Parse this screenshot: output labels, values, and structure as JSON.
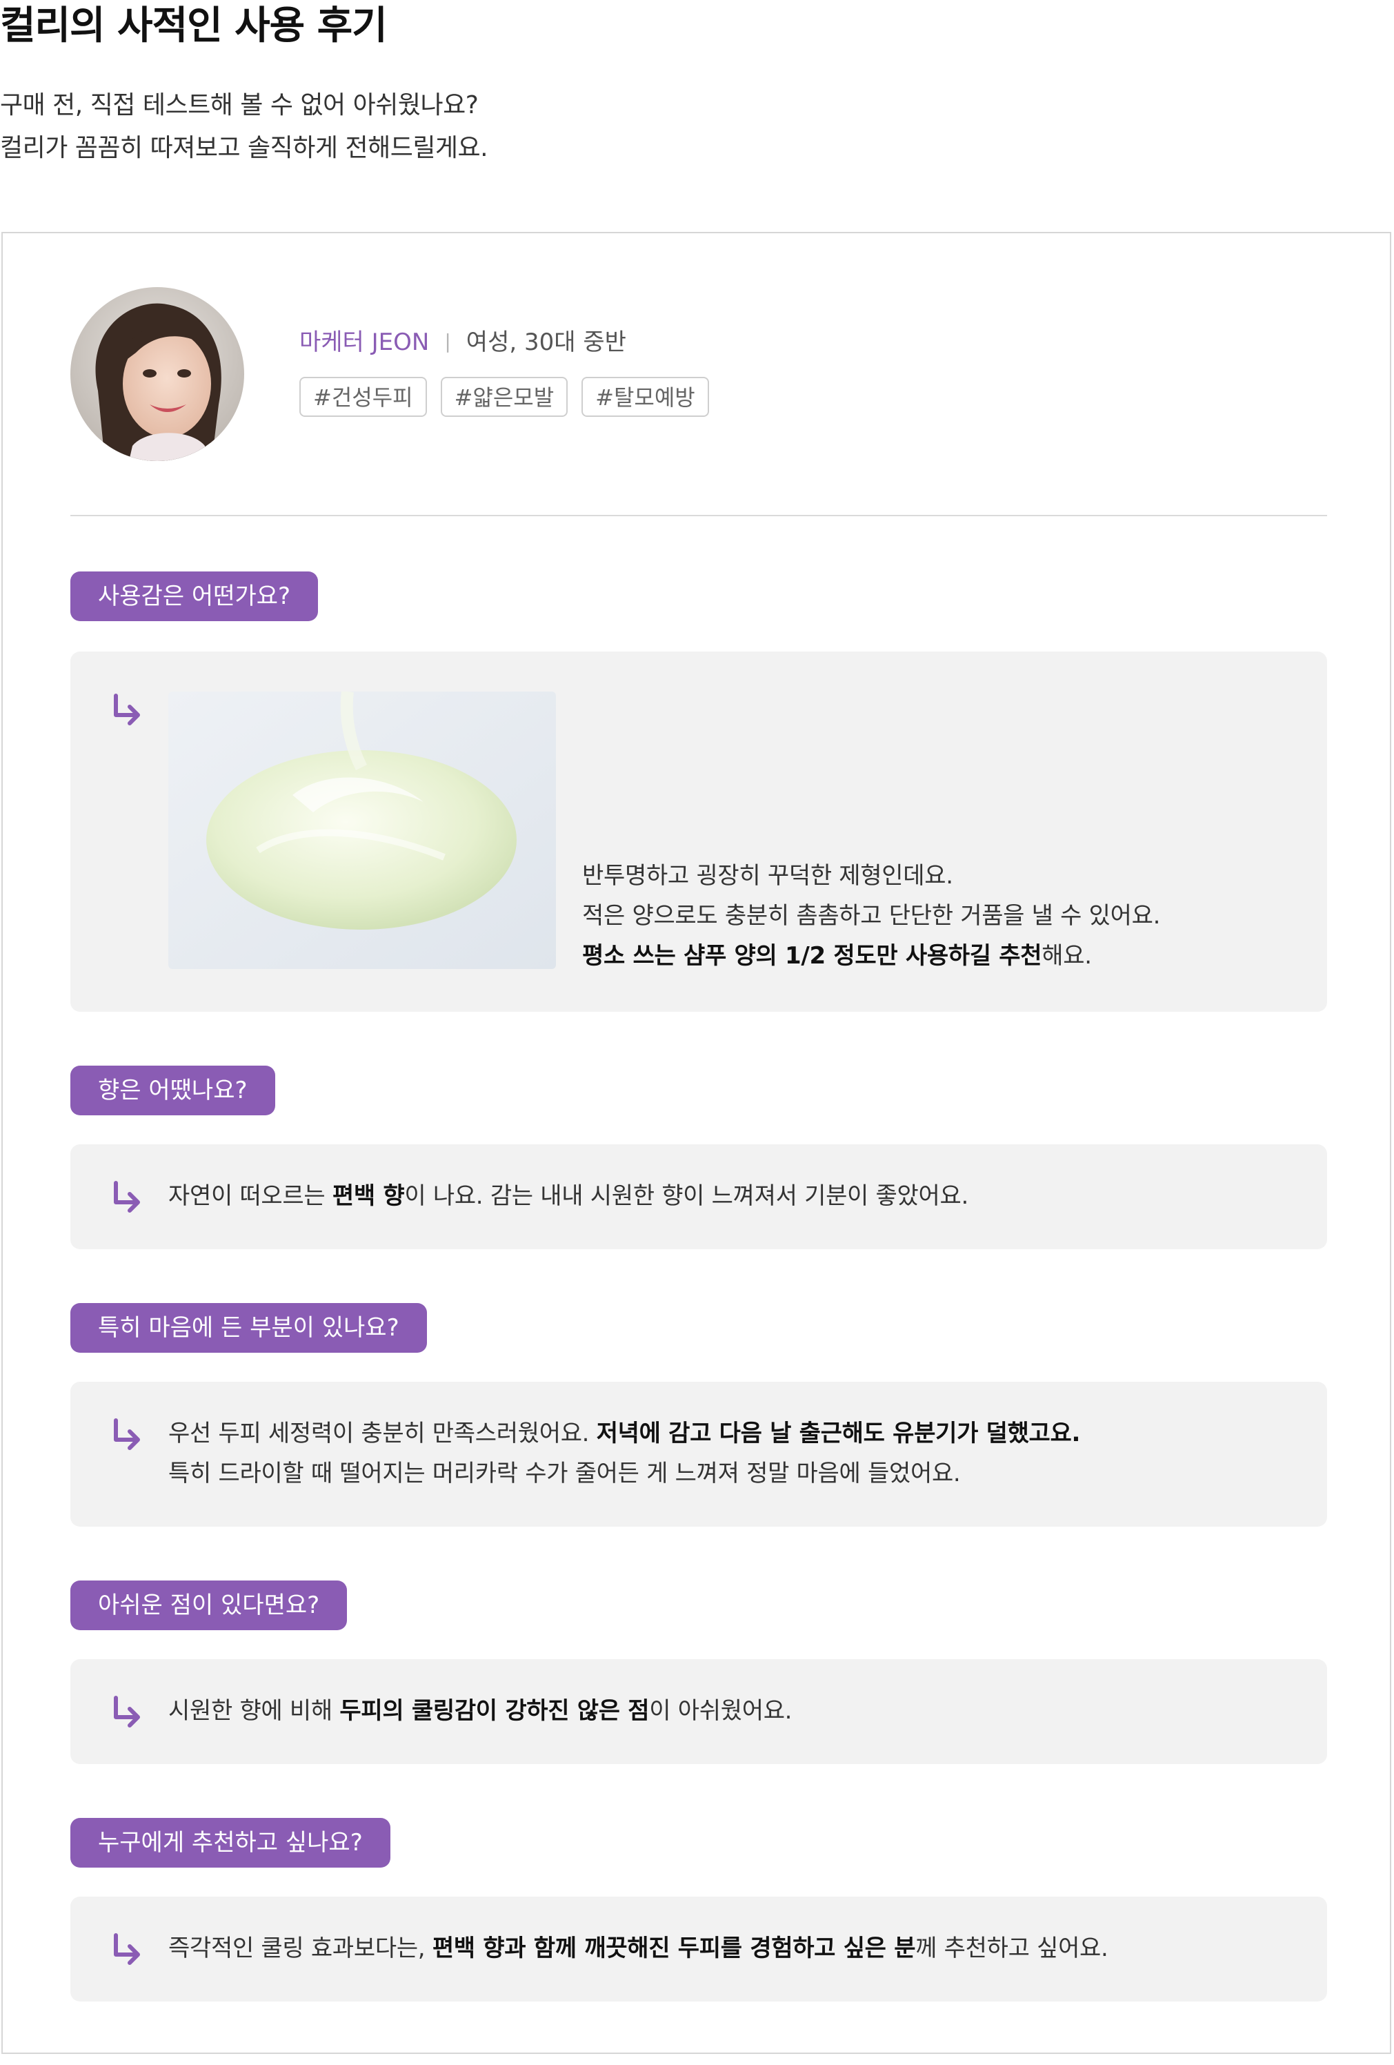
{
  "page": {
    "title": "컬리의 사적인 사용 후기",
    "intro_lines": [
      "구매 전, 직접 테스트해 볼 수 없어 아쉬웠나요?",
      "컬리가 꼼꼼히 따져보고 솔직하게 전해드릴게요."
    ]
  },
  "reviewer": {
    "name": "마케터 JEON",
    "separator": "|",
    "info": "여성, 30대 중반",
    "tags": [
      "#건성두피",
      "#얇은모발",
      "#탈모예방"
    ]
  },
  "colors": {
    "accent": "#8a5cb4",
    "answer_bg": "#f2f2f2",
    "border": "#d6d6d6"
  },
  "icons": {
    "answer_arrow": "arrow-down-right-icon"
  },
  "qa": [
    {
      "question": "사용감은 어떤가요?",
      "lines": [
        [
          {
            "t": "반투명하고 굉장히 꾸덕한 제형인데요."
          }
        ],
        [
          {
            "t": "적은 양으로도 충분히 촘촘하고 단단한 거품을 낼 수 있어요."
          }
        ],
        [
          {
            "t": "평소 쓰는 샴푸 양의 1/2 정도만 사용하길 추천",
            "b": true
          },
          {
            "t": "해요."
          }
        ]
      ]
    },
    {
      "question": "향은 어땠나요?",
      "lines": [
        [
          {
            "t": "자연이 떠오르는 "
          },
          {
            "t": "편백 향",
            "b": true
          },
          {
            "t": "이 나요. 감는 내내 시원한 향이 느껴져서 기분이 좋았어요."
          }
        ]
      ]
    },
    {
      "question": "특히 마음에 든 부분이 있나요?",
      "lines": [
        [
          {
            "t": "우선 두피 세정력이 충분히 만족스러웠어요. "
          },
          {
            "t": "저녁에 감고 다음 날 출근해도 유분기가 덜했고요.",
            "b": true
          }
        ],
        [
          {
            "t": "특히 드라이할 때 떨어지는 머리카락 수가 줄어든 게 느껴져 정말 마음에 들었어요."
          }
        ]
      ]
    },
    {
      "question": "아쉬운 점이 있다면요?",
      "lines": [
        [
          {
            "t": "시원한 향에 비해 "
          },
          {
            "t": "두피의 쿨링감이 강하진 않은 점",
            "b": true
          },
          {
            "t": "이 아쉬웠어요."
          }
        ]
      ]
    },
    {
      "question": "누구에게 추천하고 싶나요?",
      "lines": [
        [
          {
            "t": "즉각적인 쿨링 효과보다는, "
          },
          {
            "t": "편백 향과 함께 깨끗해진 두피를 경험하고 싶은 분",
            "b": true
          },
          {
            "t": "께 추천하고 싶어요."
          }
        ]
      ]
    }
  ]
}
